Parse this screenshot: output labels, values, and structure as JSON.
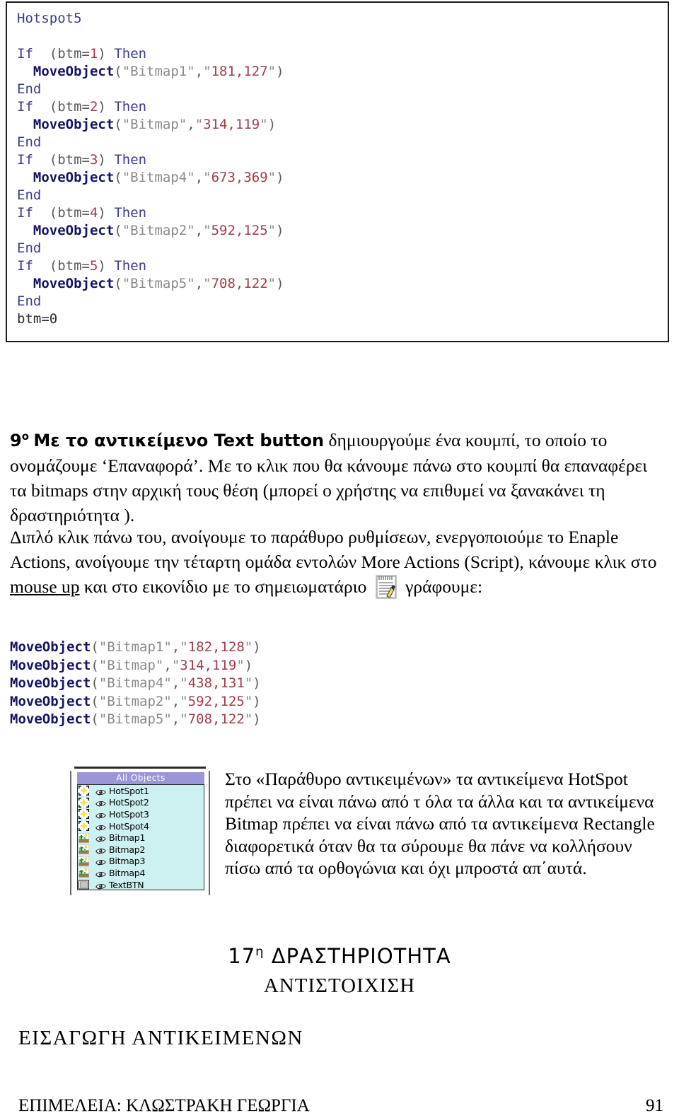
{
  "code_block_1": {
    "title_line": "Hotspot5",
    "lines": [
      {
        "tokens": [
          {
            "t": "Hotspot5",
            "c": "plain"
          }
        ]
      },
      {
        "tokens": []
      },
      {
        "tokens": [
          {
            "t": "If",
            "c": "kw"
          },
          {
            "t": "  (btm=",
            "c": "punct"
          },
          {
            "t": "1",
            "c": "num"
          },
          {
            "t": ") ",
            "c": "punct"
          },
          {
            "t": "Then",
            "c": "kw"
          }
        ]
      },
      {
        "tokens": [
          {
            "t": "  ",
            "c": "punct"
          },
          {
            "t": "MoveObject",
            "c": "fn"
          },
          {
            "t": "(",
            "c": "punct"
          },
          {
            "t": "\"Bitmap1\"",
            "c": "str"
          },
          {
            "t": ",",
            "c": "punct"
          },
          {
            "t": "\"",
            "c": "str"
          },
          {
            "t": "181,127",
            "c": "num"
          },
          {
            "t": "\"",
            "c": "str"
          },
          {
            "t": ")",
            "c": "punct"
          }
        ]
      },
      {
        "tokens": [
          {
            "t": "End",
            "c": "kw"
          }
        ]
      },
      {
        "tokens": [
          {
            "t": "If",
            "c": "kw"
          },
          {
            "t": "  (btm=",
            "c": "punct"
          },
          {
            "t": "2",
            "c": "num"
          },
          {
            "t": ") ",
            "c": "punct"
          },
          {
            "t": "Then",
            "c": "kw"
          }
        ]
      },
      {
        "tokens": [
          {
            "t": "  ",
            "c": "punct"
          },
          {
            "t": "MoveObject",
            "c": "fn"
          },
          {
            "t": "(",
            "c": "punct"
          },
          {
            "t": "\"Bitmap\"",
            "c": "str"
          },
          {
            "t": ",",
            "c": "punct"
          },
          {
            "t": "\"",
            "c": "str"
          },
          {
            "t": "314,119",
            "c": "num"
          },
          {
            "t": "\"",
            "c": "str"
          },
          {
            "t": ")",
            "c": "punct"
          }
        ]
      },
      {
        "tokens": [
          {
            "t": "End",
            "c": "kw"
          }
        ]
      },
      {
        "tokens": [
          {
            "t": "If",
            "c": "kw"
          },
          {
            "t": "  (btm=",
            "c": "punct"
          },
          {
            "t": "3",
            "c": "num"
          },
          {
            "t": ") ",
            "c": "punct"
          },
          {
            "t": "Then",
            "c": "kw"
          }
        ]
      },
      {
        "tokens": [
          {
            "t": "  ",
            "c": "punct"
          },
          {
            "t": "MoveObject",
            "c": "fn"
          },
          {
            "t": "(",
            "c": "punct"
          },
          {
            "t": "\"Bitmap4\"",
            "c": "str"
          },
          {
            "t": ",",
            "c": "punct"
          },
          {
            "t": "\"",
            "c": "str"
          },
          {
            "t": "673,369",
            "c": "num"
          },
          {
            "t": "\"",
            "c": "str"
          },
          {
            "t": ")",
            "c": "punct"
          }
        ]
      },
      {
        "tokens": [
          {
            "t": "End",
            "c": "kw"
          }
        ]
      },
      {
        "tokens": [
          {
            "t": "If",
            "c": "kw"
          },
          {
            "t": "  (btm=",
            "c": "punct"
          },
          {
            "t": "4",
            "c": "num"
          },
          {
            "t": ") ",
            "c": "punct"
          },
          {
            "t": "Then",
            "c": "kw"
          }
        ]
      },
      {
        "tokens": [
          {
            "t": "  ",
            "c": "punct"
          },
          {
            "t": "MoveObject",
            "c": "fn"
          },
          {
            "t": "(",
            "c": "punct"
          },
          {
            "t": "\"Bitmap2\"",
            "c": "str"
          },
          {
            "t": ",",
            "c": "punct"
          },
          {
            "t": "\"",
            "c": "str"
          },
          {
            "t": "592,125",
            "c": "num"
          },
          {
            "t": "\"",
            "c": "str"
          },
          {
            "t": ")",
            "c": "punct"
          }
        ]
      },
      {
        "tokens": [
          {
            "t": "End",
            "c": "kw"
          }
        ]
      },
      {
        "tokens": [
          {
            "t": "If",
            "c": "kw"
          },
          {
            "t": "  (btm=",
            "c": "punct"
          },
          {
            "t": "5",
            "c": "num"
          },
          {
            "t": ") ",
            "c": "punct"
          },
          {
            "t": "Then",
            "c": "kw"
          }
        ]
      },
      {
        "tokens": [
          {
            "t": "  ",
            "c": "punct"
          },
          {
            "t": "MoveObject",
            "c": "fn"
          },
          {
            "t": "(",
            "c": "punct"
          },
          {
            "t": "\"Bitmap5\"",
            "c": "str"
          },
          {
            "t": ",",
            "c": "punct"
          },
          {
            "t": "\"",
            "c": "str"
          },
          {
            "t": "708,122",
            "c": "num"
          },
          {
            "t": "\"",
            "c": "str"
          },
          {
            "t": ")",
            "c": "punct"
          }
        ]
      },
      {
        "tokens": [
          {
            "t": "End",
            "c": "kw"
          }
        ]
      },
      {
        "tokens": [
          {
            "t": "btm=0",
            "c": "black"
          }
        ]
      }
    ]
  },
  "paragraph_9": {
    "number": "9",
    "ordinal_suffix": "ο",
    "bold_lead": "Με το αντικείμενο Text button",
    "rest": " δημιουργούμε ένα κουμπί, το οποίο το ονομάζουμε ‘Επαναφορά’. Με το κλικ που θα κάνουμε πάνω στο κουμπί θα επαναφέρει τα bitmaps στην αρχική τους θέση (μπορεί ο χρήστης να επιθυμεί να ξανακάνει τη δραστηριότητα )."
  },
  "paragraph_double_click": {
    "part1": "Διπλό κλικ πάνω του, ανοίγουμε το παράθυρο ρυθμίσεων, ενεργοποιούμε το Enaple Actions, ανοίγουμε την τέταρτη ομάδα εντολών More Actions (Script), κάνουμε κλικ στο ",
    "underlined": "mouse up",
    "part2": " και  στο εικονίδιο με το σημειωματάριο ",
    "icon_name": "notepad-icon",
    "part3": " γράφουμε:"
  },
  "code_block_2": {
    "lines": [
      {
        "fn": "MoveObject",
        "open": "(",
        "str1": "\"Bitmap1\"",
        "comma": ",",
        "q1": "\"",
        "coords": "182,128",
        "q2": "\"",
        "close": ")"
      },
      {
        "fn": "MoveObject",
        "open": "(",
        "str1": "\"Bitmap\"",
        "comma": ",",
        "q1": "\"",
        "coords": "314,119",
        "q2": "\"",
        "close": ")"
      },
      {
        "fn": "MoveObject",
        "open": "(",
        "str1": "\"Bitmap4\"",
        "comma": ",",
        "q1": "\"",
        "coords": "438,131",
        "q2": "\"",
        "close": ")"
      },
      {
        "fn": "MoveObject",
        "open": "(",
        "str1": "\"Bitmap2\"",
        "comma": ",",
        "q1": "\"",
        "coords": "592,125",
        "q2": "\"",
        "close": ")"
      },
      {
        "fn": "MoveObject",
        "open": "(",
        "str1": "\"Bitmap5\"",
        "comma": ",",
        "q1": "\"",
        "coords": "708,122",
        "q2": "\"",
        "close": ")"
      }
    ]
  },
  "objects_panel": {
    "header": "All Objects",
    "header_bg": "#9a96d8",
    "list_bg": "#cdf0f0",
    "rows": [
      {
        "label": "HotSpot1",
        "type_icon": "hotspot-icon",
        "eye_icon": "eye-icon"
      },
      {
        "label": "HotSpot2",
        "type_icon": "hotspot-icon",
        "eye_icon": "eye-icon"
      },
      {
        "label": "HotSpot3",
        "type_icon": "hotspot-icon",
        "eye_icon": "eye-icon"
      },
      {
        "label": "HotSpot4",
        "type_icon": "hotspot-icon",
        "eye_icon": "eye-icon"
      },
      {
        "label": "Bitmap1",
        "type_icon": "bitmap-icon",
        "eye_icon": "eye-icon"
      },
      {
        "label": "Bitmap2",
        "type_icon": "bitmap-icon",
        "eye_icon": "eye-icon"
      },
      {
        "label": "Bitmap3",
        "type_icon": "bitmap-icon",
        "eye_icon": "eye-icon"
      },
      {
        "label": "Bitmap4",
        "type_icon": "bitmap-icon",
        "eye_icon": "eye-icon"
      },
      {
        "label": "TextBTN",
        "type_icon": "button-icon",
        "eye_icon": "eye-icon"
      }
    ]
  },
  "paragraph_window": {
    "text": "Στο «Παράθυρο αντικειμένων» τα αντικείμενα HotSpot πρέπει να είναι πάνω από τ όλα τα άλλα και τα αντικείμενα Bitmap πρέπει να είναι πάνω από τα αντικείμενα Rectangle διαφορετικά όταν θα τα σύρουμε θα πάνε να κολλήσουν πίσω από τα ορθογώνια και όχι μπροστά απ΄αυτά."
  },
  "headings": {
    "activity_number": "17",
    "activity_suffix": "η",
    "activity_word": " ΔΡΑΣΤΗΡΙΟΤΗΤΑ",
    "activity_subtitle": "ΑΝΤΙΣΤΟΙΧΙΣΗ",
    "section": "ΕΙΣΑΓΩΓΗ ΑΝΤΙΚΕΙΜΕΝΩΝ"
  },
  "footer": {
    "credit": "ΕΠΙΜΕΛΕΙΑ: ΚΛΩΣΤΡΑΚΗ ΓΕΩΡΓΙΑ",
    "page_number": "91"
  }
}
